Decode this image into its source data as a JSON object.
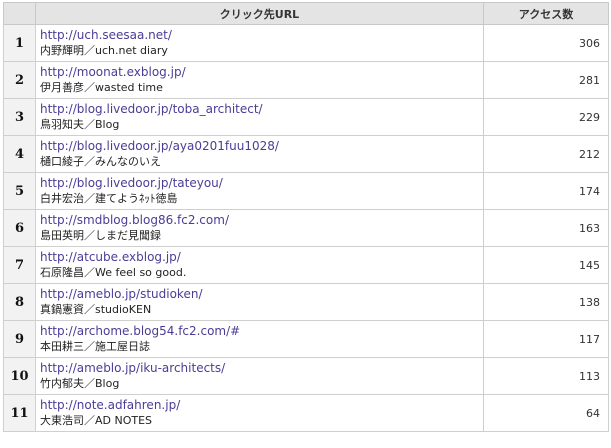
{
  "table": {
    "header_rank": "",
    "header_url": "クリック先URL",
    "header_count": "アクセス数",
    "rows": [
      {
        "rank": "1",
        "url": "http://uch.seesaa.net/",
        "author": "内野輝明／uch.net diary",
        "count": "306"
      },
      {
        "rank": "2",
        "url": "http://moonat.exblog.jp/",
        "author": "伊月善彦／wasted time",
        "count": "281"
      },
      {
        "rank": "3",
        "url": "http://blog.livedoor.jp/toba_architect/",
        "author": "鳥羽知夫／Blog",
        "count": "229"
      },
      {
        "rank": "4",
        "url": "http://blog.livedoor.jp/aya0201fuu1028/",
        "author": "樋口綾子／みんなのいえ",
        "count": "212"
      },
      {
        "rank": "5",
        "url": "http://blog.livedoor.jp/tateyou/",
        "author": "白井宏治／建てようﾈｯﾄ徳島",
        "count": "174"
      },
      {
        "rank": "6",
        "url": "http://smdblog.blog86.fc2.com/",
        "author": "島田英明／しまだ見聞録",
        "count": "163"
      },
      {
        "rank": "7",
        "url": "http://atcube.exblog.jp/",
        "author": "石原隆昌／We feel so good.",
        "count": "145"
      },
      {
        "rank": "8",
        "url": "http://ameblo.jp/studioken/",
        "author": "真鍋憲資／studioKEN",
        "count": "138"
      },
      {
        "rank": "9",
        "url": "http://archome.blog54.fc2.com/#",
        "author": "本田耕三／施工屋日誌",
        "count": "117"
      },
      {
        "rank": "10",
        "url": "http://ameblo.jp/iku-architects/",
        "author": "竹内郁夫／Blog",
        "count": "113"
      },
      {
        "rank": "11",
        "url": "http://note.adfahren.jp/",
        "author": "大東浩司／AD NOTES",
        "count": "64"
      }
    ]
  },
  "colors": {
    "link": "#4b3c96",
    "header_bg": "#e4e4e4",
    "rank_bg": "#f2f2f2",
    "border": "#cfcfcf"
  }
}
